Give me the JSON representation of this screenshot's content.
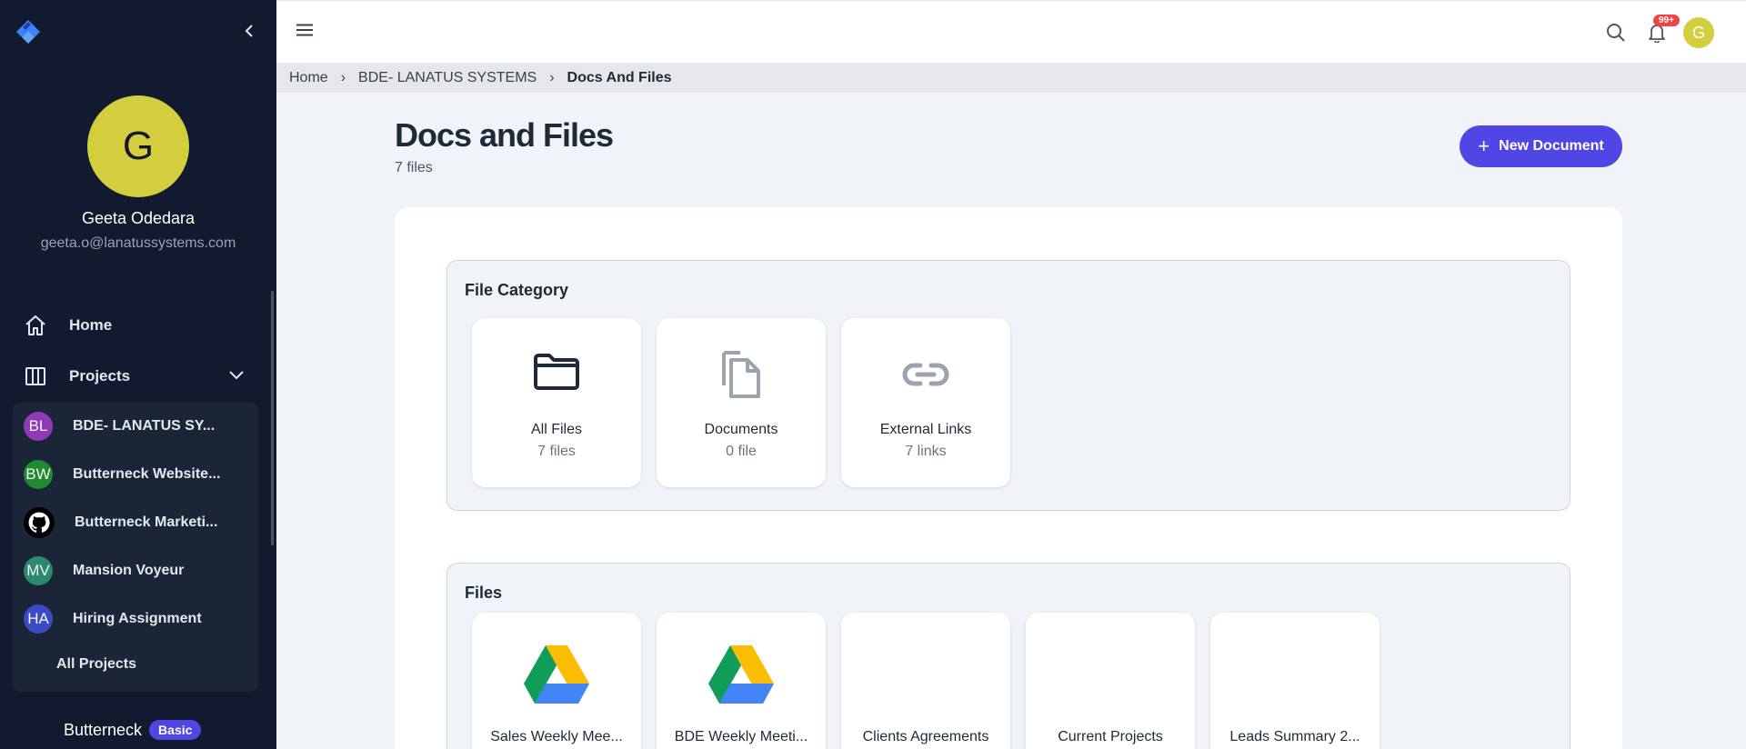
{
  "sidebar": {
    "user": {
      "initial": "G",
      "name": "Geeta Odedara",
      "email": "geeta.o@lanatussystems.com"
    },
    "nav": {
      "home": "Home",
      "projects": "Projects"
    },
    "projects": [
      {
        "initials": "BL",
        "name": "BDE- LANATUS SY...",
        "color": "#8e3bb5"
      },
      {
        "initials": "BW",
        "name": "Butterneck Website...",
        "color": "#1f8a2e"
      },
      {
        "initials": "",
        "name": "Butterneck Marketi...",
        "color": "#000000"
      },
      {
        "initials": "MV",
        "name": "Mansion Voyeur",
        "color": "#2b8a6b"
      },
      {
        "initials": "HA",
        "name": "Hiring Assignment",
        "color": "#3b4bc4"
      }
    ],
    "all_projects": "All Projects",
    "workspace": {
      "name": "Butterneck",
      "plan": "Basic"
    }
  },
  "topbar": {
    "notif_count": "99+",
    "avatar_initial": "G"
  },
  "breadcrumb": {
    "items": [
      "Home",
      "BDE- LANATUS SYSTEMS"
    ],
    "current": "Docs And Files"
  },
  "page": {
    "title": "Docs and Files",
    "count": "7 files",
    "new_button": "New Document"
  },
  "categories": {
    "title": "File Category",
    "items": [
      {
        "label": "All Files",
        "sub": "7 files",
        "icon": "folder-icon"
      },
      {
        "label": "Documents",
        "sub": "0 file",
        "icon": "document-icon"
      },
      {
        "label": "External Links",
        "sub": "7 links",
        "icon": "link-icon"
      }
    ]
  },
  "files": {
    "title": "Files",
    "items": [
      {
        "label": "Sales Weekly Mee...",
        "icon": "google-drive-icon"
      },
      {
        "label": "BDE Weekly Meeti...",
        "icon": "google-drive-icon"
      },
      {
        "label": "Clients Agreements",
        "icon": ""
      },
      {
        "label": "Current Projects",
        "icon": ""
      },
      {
        "label": "Leads Summary 2...",
        "icon": ""
      }
    ]
  },
  "colors": {
    "accent": "#4f46e5",
    "sidebar_bg": "#111a2e",
    "avatar": "#d4ce3f",
    "badge": "#ef4444"
  }
}
